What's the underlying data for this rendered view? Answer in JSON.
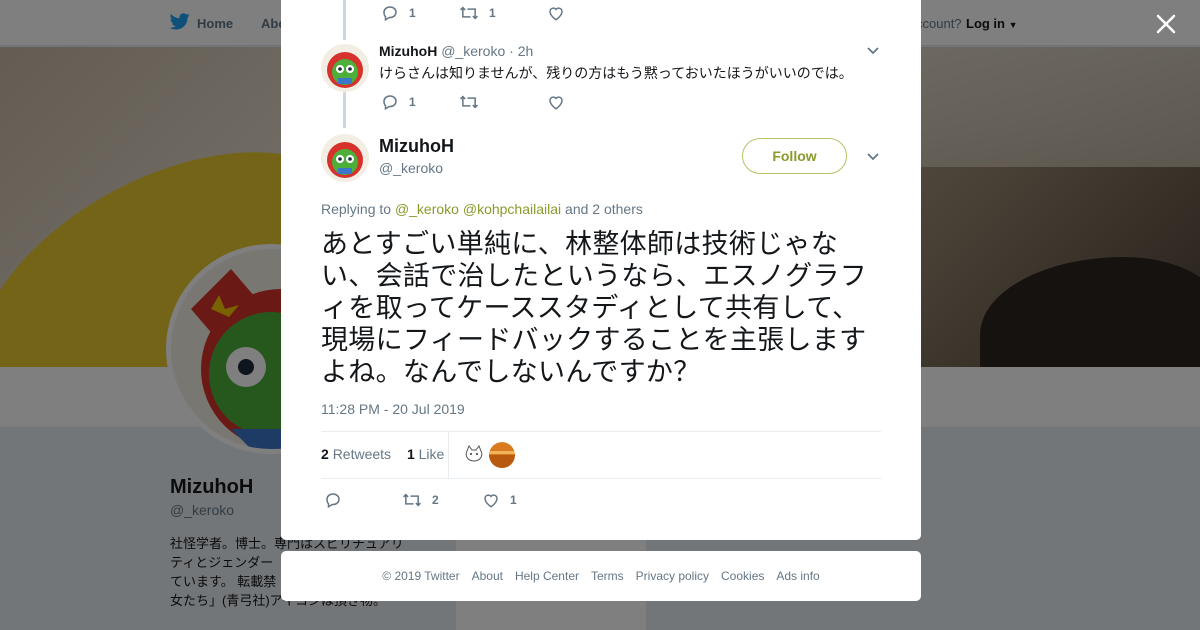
{
  "nav": {
    "home_label": "Home",
    "about_label": "Abo",
    "account_prompt": "ccount?",
    "login_label": "Log in"
  },
  "background_profile": {
    "name": "MizuhoH",
    "handle": "@_keroko",
    "bio_lines": [
      "社怪学者。博士。専門はスピリチュアリ",
      "ティとジェンダー",
      "ています。 転載禁",
      "女たち」(青弓社)アイコンは頂き物。"
    ]
  },
  "thread": {
    "prev_tweet_actions": {
      "replies": "1",
      "retweets": "1",
      "likes": ""
    },
    "reply": {
      "name": "MizuhoH",
      "handle": "@_keroko",
      "time": "· 2h",
      "text": "けらさんは知りませんが、残りの方はもう黙っておいたほうがいいのでは。",
      "replies": "1",
      "retweets": "",
      "likes": ""
    }
  },
  "tweet": {
    "name": "MizuhoH",
    "handle": "@_keroko",
    "follow_label": "Follow",
    "replying_prefix": "Replying to",
    "mention_1": "@_keroko",
    "mention_2": "@kohpchailailai",
    "replying_suffix": "and 2 others",
    "text": "あとすごい単純に、林整体師は技術じゃない、会話で治したというなら、エスノグラフィを取ってケーススタディとして共有して、現場にフィードバックすることを主張しますよね。なんでしないんですか？",
    "timestamp": "11:28 PM - 20 Jul 2019",
    "retweet_count": "2",
    "retweet_label": "Retweets",
    "like_count": "1",
    "like_label": "Like",
    "actions": {
      "replies": "",
      "retweets": "2",
      "likes": "1"
    }
  },
  "footer": {
    "links": [
      "© 2019 Twitter",
      "About",
      "Help Center",
      "Terms",
      "Privacy policy",
      "Cookies",
      "Ads info"
    ]
  },
  "colors": {
    "accent": "#8a9a2a",
    "accent_border": "#b5c46a",
    "muted": "#657786",
    "text": "#14171a"
  }
}
